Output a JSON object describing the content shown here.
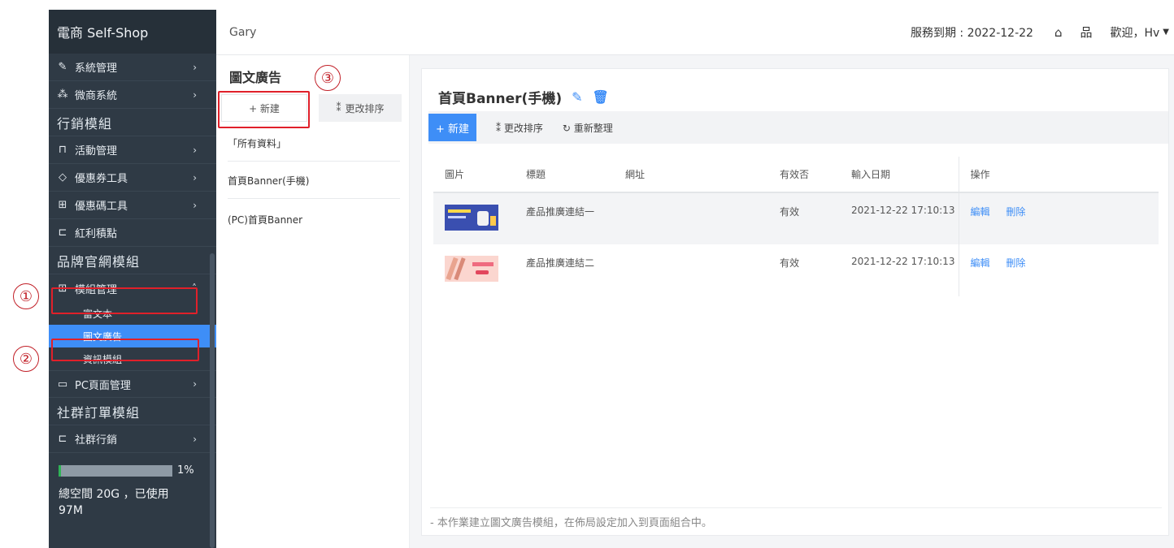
{
  "sidebar": {
    "brand": "電商 Self-Shop",
    "items": [
      {
        "label": "系統管理",
        "icon": "tools-icon"
      },
      {
        "label": "微商系統",
        "icon": "network-icon"
      }
    ],
    "section_marketing": "行銷模組",
    "marketing_items": [
      {
        "label": "活動管理",
        "icon": "bag-icon"
      },
      {
        "label": "優惠券工具",
        "icon": "tag-icon"
      },
      {
        "label": "優惠碼工具",
        "icon": "gift-icon"
      },
      {
        "label": "紅利積點",
        "icon": "cart-icon"
      }
    ],
    "section_brand": "品牌官網模組",
    "module_mgmt": {
      "label": "模組管理",
      "icon": "grid-icon"
    },
    "sub_items": [
      "富文本",
      "圖文廣告",
      "資訊模組"
    ],
    "pc_page": {
      "label": "PC頁面管理",
      "icon": "monitor-icon"
    },
    "section_social": "社群訂單模組",
    "social_items": [
      {
        "label": "社群行銷",
        "icon": "cart-icon"
      }
    ],
    "storage": {
      "percent_label": "1%",
      "percent": 1,
      "text_line1": "總空間 20G ，已使用",
      "text_line2": "97M"
    }
  },
  "header": {
    "user": "Gary",
    "service": "服務到期 : 2022-12-22",
    "welcome": "歡迎，Hv"
  },
  "listpanel": {
    "title": "圖文廣告",
    "new_label": "+ 新建",
    "sort_label": "更改排序",
    "entries": [
      "「所有資料」",
      "首頁Banner(手機)",
      "(PC)首頁Banner"
    ]
  },
  "main": {
    "title": "首頁Banner(手機)",
    "toolbar": {
      "new_label": "+ 新建",
      "sort_label": "更改排序",
      "refresh_label": "重新整理"
    },
    "columns": [
      "圖片",
      "標題",
      "網址",
      "有效否",
      "輸入日期",
      "操作"
    ],
    "rows": [
      {
        "title": "產品推廣連結一",
        "url": "",
        "valid": "有效",
        "date": "2021-12-22 17:10:13",
        "edit": "編輯",
        "delete": "刪除"
      },
      {
        "title": "產品推廣連結二",
        "url": "",
        "valid": "有效",
        "date": "2021-12-22 17:10:13",
        "edit": "編輯",
        "delete": "刪除"
      }
    ],
    "footer_note": "- 本作業建立圖文廣告模組，在佈局設定加入到頁面組合中。"
  },
  "annotations": [
    "①",
    "②",
    "③"
  ],
  "colors": {
    "accent": "#3e8ef7",
    "sidebar": "#2f3a45",
    "highlight": "#e0202a"
  }
}
